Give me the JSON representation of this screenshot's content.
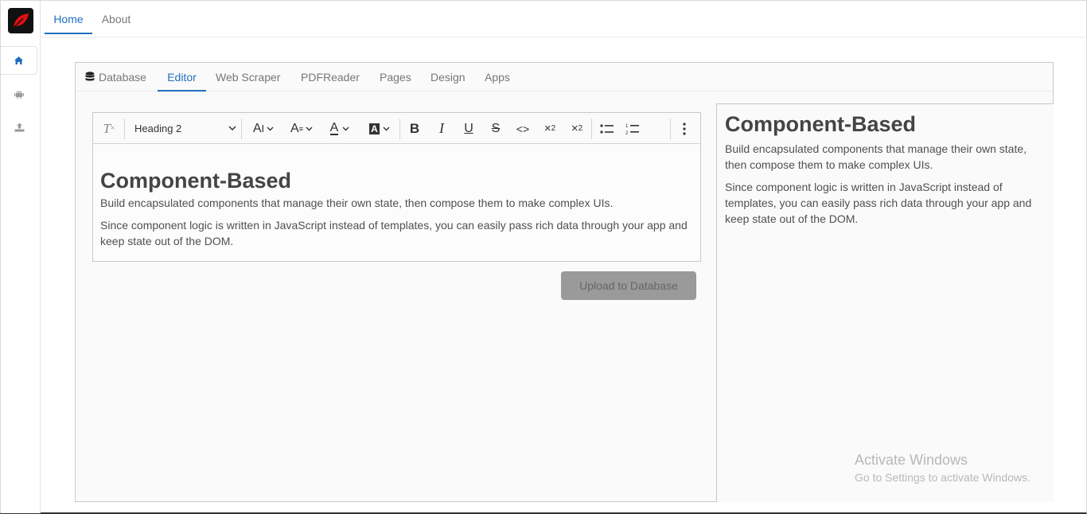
{
  "nav": {
    "home": "Home",
    "about": "About"
  },
  "sidebar": {
    "icons": [
      "home-icon",
      "android-icon",
      "upload-icon"
    ]
  },
  "tabs": [
    "Database",
    "Editor",
    "Web Scraper",
    "PDFReader",
    "Pages",
    "Design",
    "Apps"
  ],
  "toolbar": {
    "heading_select": "Heading 2"
  },
  "editor": {
    "heading": "Component-Based",
    "p1": "Build encapsulated components that manage their own state, then compose them to make complex UIs.",
    "p2": "Since component logic is written in JavaScript instead of templates, you can easily pass rich data through your app and keep state out of the DOM."
  },
  "upload_button": "Upload to Database",
  "preview": {
    "heading": "Component-Based",
    "p1": "Build encapsulated components that manage their own state, then compose them to make complex UIs.",
    "p2": "Since component logic is written in JavaScript instead of templates, you can easily pass rich data through your app and keep state out of the DOM."
  },
  "watermark": {
    "line1": "Activate Windows",
    "line2": "Go to Settings to activate Windows."
  },
  "colors": {
    "accent": "#1f6fbf",
    "logo_bg": "#111111",
    "logo_leaf": "#e01010"
  }
}
